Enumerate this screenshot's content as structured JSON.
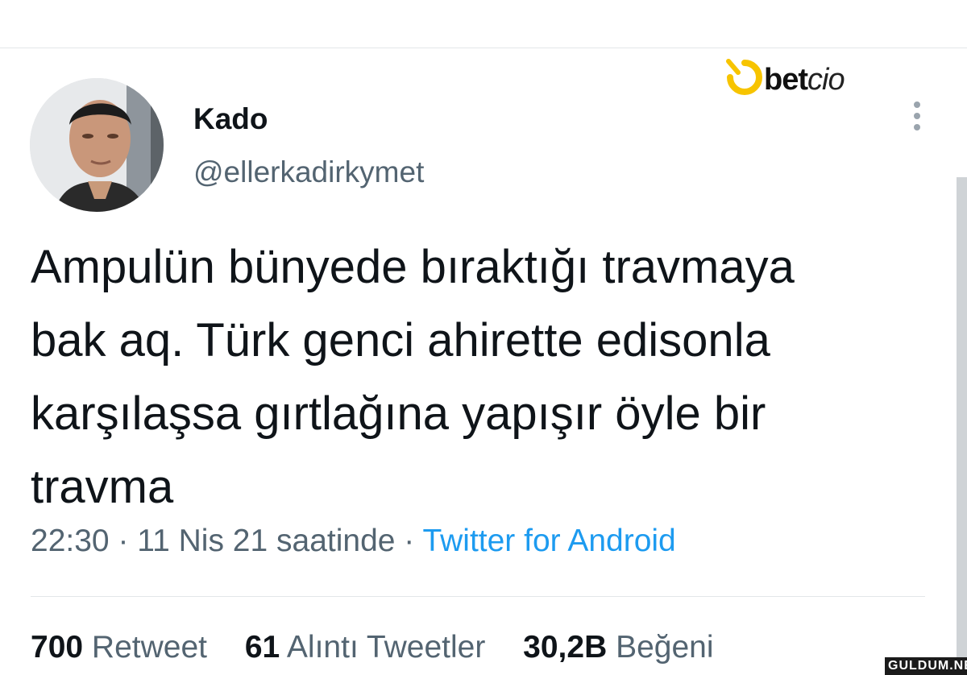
{
  "brand": {
    "name_bold": "bet",
    "name_light": "cio",
    "accent": "#f7c400"
  },
  "author": {
    "display_name": "Kado",
    "handle": "@ellerkadirkymet"
  },
  "tweet": {
    "lines": [
      "Ampulün bünyede bıraktığı travmaya",
      "bak aq. Türk genci ahirette edisonla",
      "karşılaşsa gırtlağına yapışır öyle bir",
      "travma"
    ],
    "time": "22:30",
    "date": "11 Nis 21 saatinde",
    "separator": "·",
    "source": "Twitter for Android"
  },
  "stats": [
    {
      "count": "700",
      "label": "Retweet"
    },
    {
      "count": "61",
      "label": "Alıntı Tweetler"
    },
    {
      "count": "30,2B",
      "label": "Beğeni"
    }
  ],
  "watermark": "GULDUM.NET",
  "colors": {
    "link": "#1d9bf0",
    "muted": "#536471",
    "text": "#0f1419"
  },
  "icons": {
    "more": "more-vertical-icon",
    "logo_mark": "betcio-logo-mark"
  }
}
